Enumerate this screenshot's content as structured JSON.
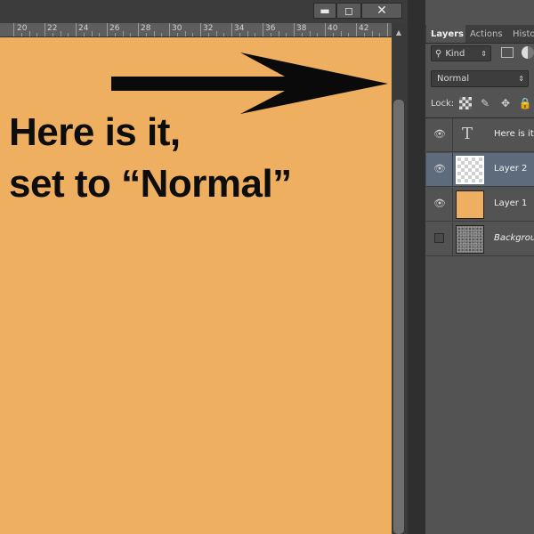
{
  "window": {
    "min_label": "▬",
    "max_label": "◻",
    "close_label": "✕"
  },
  "ruler": {
    "ticks": [
      "20",
      "22",
      "24",
      "26",
      "28",
      "30",
      "32",
      "34",
      "36",
      "38",
      "40",
      "42"
    ]
  },
  "canvas": {
    "line1": "Here is it,",
    "line2": "set to “Normal”",
    "background": "#efaf60",
    "arrow_icon": "arrow-right-icon"
  },
  "panel": {
    "tabs": [
      "Layers",
      "Actions",
      "Histo"
    ],
    "filter": {
      "kind": "Kind"
    },
    "blend_mode": "Normal",
    "lock_label": "Lock:",
    "layers": [
      {
        "name": "Here is it,",
        "type": "text",
        "visible": true,
        "selected": false
      },
      {
        "name": "Layer 2",
        "type": "pixel",
        "visible": true,
        "selected": true
      },
      {
        "name": "Layer 1",
        "type": "pixel",
        "visible": true,
        "selected": false
      },
      {
        "name": "Background",
        "type": "background",
        "visible": false,
        "selected": false
      }
    ]
  }
}
